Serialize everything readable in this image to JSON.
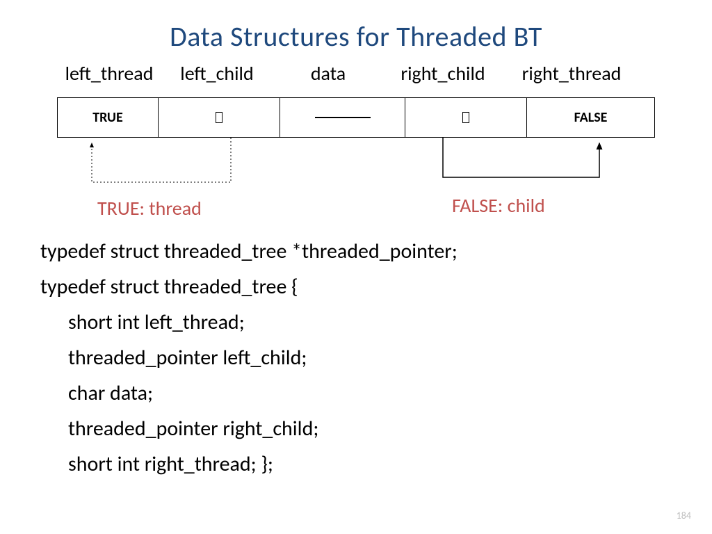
{
  "title": "Data Structures for Threaded BT",
  "fields": {
    "left_thread": "left_thread",
    "left_child": "left_child",
    "data": "data",
    "right_child": "right_child",
    "right_thread": "right_thread"
  },
  "cells": {
    "left_thread_val": "TRUE",
    "right_thread_val": "FALSE"
  },
  "annotations": {
    "true_thread": "TRUE: thread",
    "false_child": "FALSE: child"
  },
  "code": {
    "l1": "typedef struct threaded_tree *threaded_pointer;",
    "l2": "typedef struct threaded_tree {",
    "l3": "short int left_thread;",
    "l4": "threaded_pointer left_child;",
    "l5": "char data;",
    "l6": "threaded_pointer right_child;",
    "l7": "short int right_thread;  };"
  },
  "page_number": "184"
}
